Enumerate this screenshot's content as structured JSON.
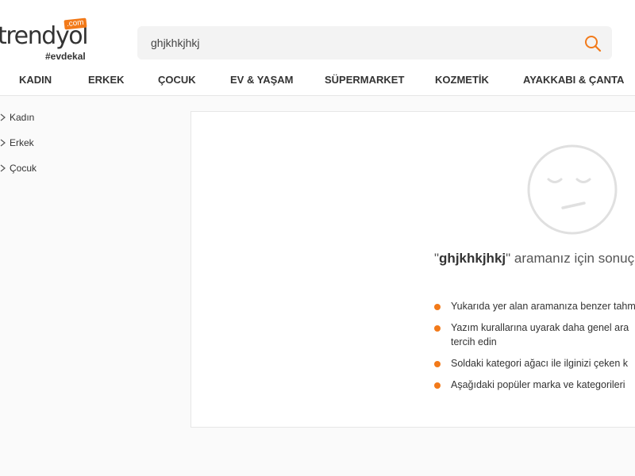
{
  "header": {
    "logo": {
      "text": "trendyol",
      "com_badge": ".com",
      "tagline": "#evdekal"
    },
    "search": {
      "value": "ghjkhkjhkj",
      "icon": "search-icon"
    }
  },
  "nav": {
    "items": [
      {
        "label": "KADIN"
      },
      {
        "label": "ERKEK"
      },
      {
        "label": "ÇOCUK"
      },
      {
        "label": "EV & YAŞAM"
      },
      {
        "label": "SÜPERMARKET"
      },
      {
        "label": "KOZMETİK"
      },
      {
        "label": "AYAKKABI & ÇANTA"
      }
    ]
  },
  "sidebar": {
    "items": [
      {
        "label": "Kadın",
        "icon": "chevron-right-icon"
      },
      {
        "label": "Erkek",
        "icon": "chevron-right-icon"
      },
      {
        "label": "Çocuk",
        "icon": "chevron-right-icon"
      }
    ]
  },
  "no_results": {
    "icon": "sad-face-icon",
    "quote_open": "\"",
    "query": "ghjkhkjhkj",
    "message_tail": "\" aramanız için sonuç b",
    "tips": [
      {
        "line1": "Yukarıda yer alan aramanıza benzer tahm",
        "line2": ""
      },
      {
        "line1": "Yazım kurallarına uyarak daha genel ara",
        "line2": "tercih edin"
      },
      {
        "line1": "Soldaki kategori ağacı ile ilginizi çeken k",
        "line2": ""
      },
      {
        "line1": "Aşağıdaki popüler marka ve kategorileri",
        "line2": ""
      }
    ]
  },
  "colors": {
    "accent": "#f27a1a",
    "icon_gray": "#e0e0e0",
    "text": "#333333",
    "background": "#fafafa"
  }
}
